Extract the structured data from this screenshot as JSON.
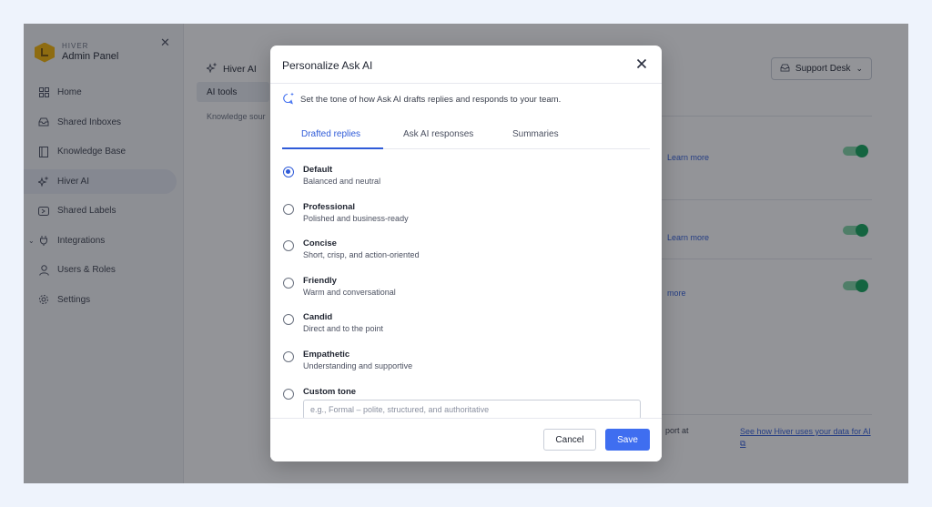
{
  "sidebar": {
    "brand_small": "HIVER",
    "brand_title": "Admin Panel",
    "items": [
      {
        "label": "Home",
        "icon": "grid-icon"
      },
      {
        "label": "Shared Inboxes",
        "icon": "inbox-icon"
      },
      {
        "label": "Knowledge Base",
        "icon": "book-icon"
      },
      {
        "label": "Hiver AI",
        "icon": "sparkle-icon",
        "active": true
      },
      {
        "label": "Shared Labels",
        "icon": "label-icon"
      },
      {
        "label": "Integrations",
        "icon": "plug-icon"
      },
      {
        "label": "Users & Roles",
        "icon": "user-icon"
      },
      {
        "label": "Settings",
        "icon": "gear-icon"
      }
    ]
  },
  "main": {
    "section_title": "Hiver AI",
    "active_tab": "AI tools",
    "truncated_label": "Knowledge sour",
    "desk_selector": "Support Desk",
    "learn_more": "Learn more",
    "learn_more_partial": "more",
    "bottom_text_partial": "port at",
    "data_link": "See how Hiver uses your data for AI ⧉"
  },
  "modal": {
    "title": "Personalize Ask AI",
    "description": "Set the tone of how Ask AI drafts replies and responds to your team.",
    "tabs": [
      "Drafted replies",
      "Ask AI responses",
      "Summaries"
    ],
    "options": [
      {
        "title": "Default",
        "subtitle": "Balanced and neutral"
      },
      {
        "title": "Professional",
        "subtitle": "Polished and business-ready"
      },
      {
        "title": "Concise",
        "subtitle": "Short, crisp, and action-oriented"
      },
      {
        "title": "Friendly",
        "subtitle": "Warm and conversational"
      },
      {
        "title": "Candid",
        "subtitle": "Direct and to the point"
      },
      {
        "title": "Empathetic",
        "subtitle": "Understanding and supportive"
      },
      {
        "title": "Custom tone",
        "subtitle": ""
      }
    ],
    "selected_option": "Default",
    "custom_placeholder": "e.g., Formal – polite, structured, and authoritative",
    "cancel_label": "Cancel",
    "save_label": "Save"
  },
  "colors": {
    "accent": "#3f6ef0",
    "toggle_on": "#10a55a",
    "link": "#2f5bd8"
  }
}
